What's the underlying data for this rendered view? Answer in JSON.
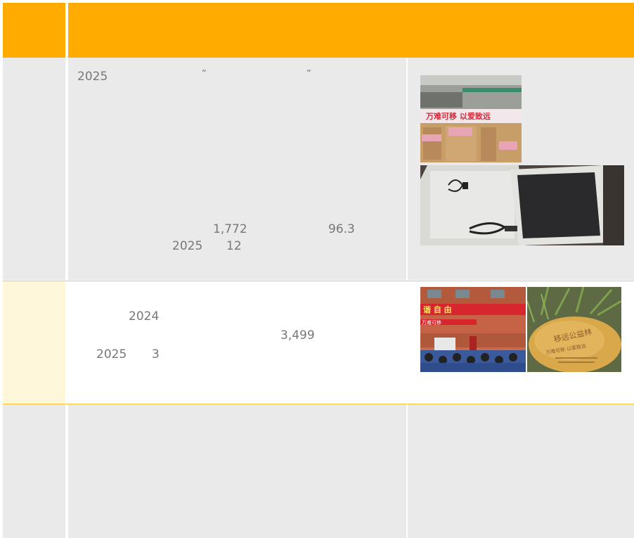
{
  "colors": {
    "header": "#ffab00",
    "row_gray": "#eaeaea",
    "row_cream": "#fff7d9",
    "divider": "#ffc33a",
    "text": "#777777"
  },
  "row1": {
    "year": "2025",
    "quote_open": "”",
    "quote_close": "”",
    "stat_count": "1,772",
    "stat_rate": "96.3",
    "date_year": "2025",
    "date_month": "12",
    "photo_top": {
      "banner_text": "万难可移 以爱致远"
    }
  },
  "row2": {
    "year_a": "2024",
    "count": "3,499",
    "date_year": "2025",
    "date_month": "3",
    "photo_left": {
      "banner_top": "谐 自 由",
      "banner_mid": "万难可移"
    },
    "photo_right": {
      "stone_line1": "移远公益林",
      "stone_line2": "万难可移 以爱致远"
    }
  }
}
